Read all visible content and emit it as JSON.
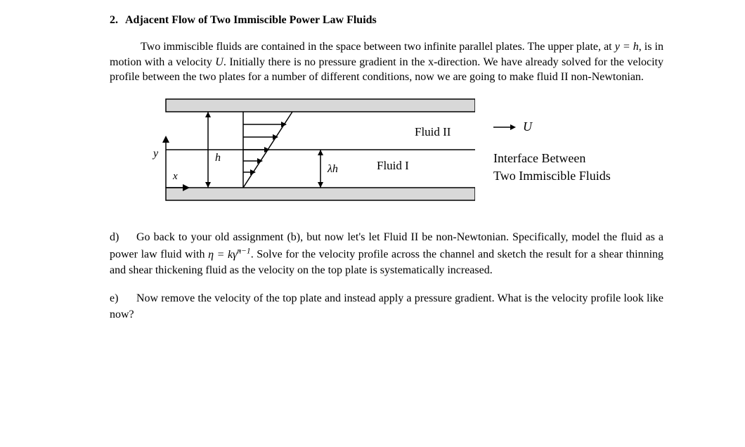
{
  "heading": {
    "number": "2.",
    "title": "Adjacent Flow of Two Immiscible Power Law Fluids"
  },
  "intro": {
    "sent1_a": "Two immiscible fluids are contained in the space between two infinite parallel plates. The upper plate, at ",
    "y_eq_h": "y = h",
    "sent1_b": ", is in motion with a velocity ",
    "U": "U",
    "sent1_c": ".  Initially there is no pressure gradient in the x-direction.   We have already solved for the velocity profile between the two plates for a number of different conditions, now we are going to make fluid II non-Newtonian."
  },
  "figure": {
    "label_y": "y",
    "label_x": "x",
    "label_h": "h",
    "label_lambda_h": "λh",
    "label_fluid1": "Fluid I",
    "label_fluid2": "Fluid II",
    "label_U": "U",
    "interface_line1": "Interface Between",
    "interface_line2": "Two Immiscible Fluids"
  },
  "questions": {
    "d_label": "d)",
    "d_text_a": "Go back to your old assignment (b), but now let's let Fluid II be non-Newtonian. Specifically, model the fluid as a power law fluid with ",
    "d_eq": "η = kγ̇",
    "d_exp": "n−1",
    "d_text_b": ". Solve for the velocity profile across the channel and sketch the result for a shear thinning and shear thickening fluid as the velocity on the top plate is systematically increased.",
    "e_label": "e)",
    "e_text": "Now remove the velocity of the top plate and instead apply a pressure gradient.  What is the velocity profile look like now?"
  }
}
